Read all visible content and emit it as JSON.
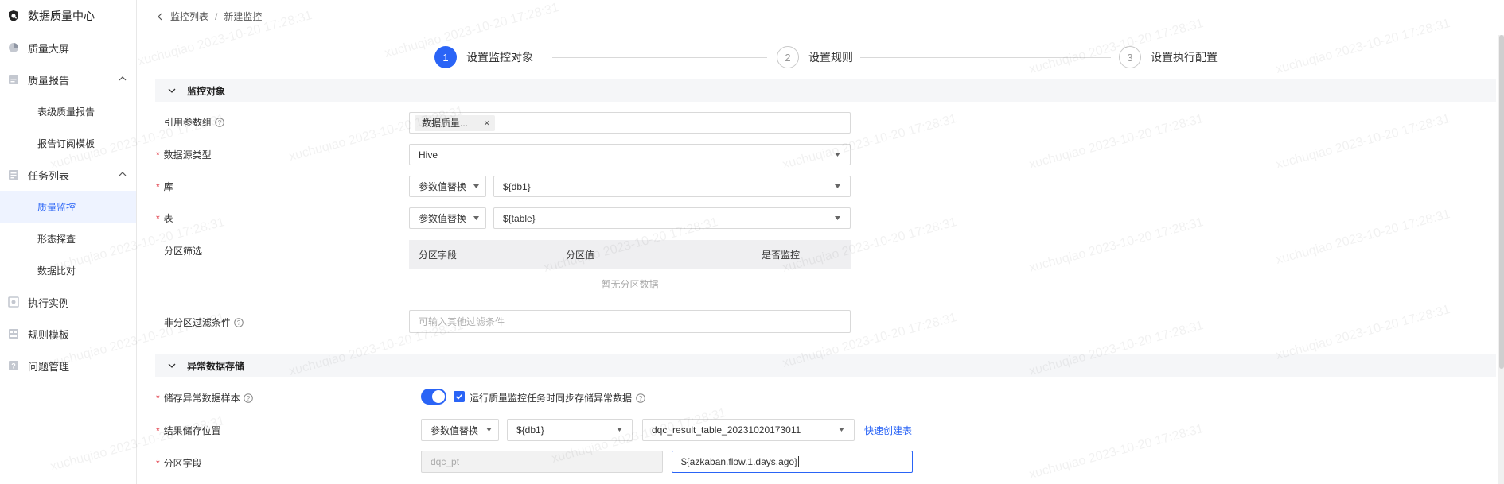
{
  "app": {
    "title": "数据质量中心"
  },
  "sidebar": {
    "items": [
      {
        "label": "质量大屏",
        "icon": "pie-chart-icon"
      },
      {
        "label": "质量报告",
        "icon": "report-icon",
        "expanded": true,
        "children": [
          {
            "label": "表级质量报告"
          },
          {
            "label": "报告订阅模板"
          }
        ]
      },
      {
        "label": "任务列表",
        "icon": "task-list-icon",
        "expanded": true,
        "children": [
          {
            "label": "质量监控",
            "active": true
          },
          {
            "label": "形态探查"
          },
          {
            "label": "数据比对"
          }
        ]
      },
      {
        "label": "执行实例",
        "icon": "instance-icon"
      },
      {
        "label": "规则模板",
        "icon": "template-icon"
      },
      {
        "label": "问题管理",
        "icon": "issue-icon"
      }
    ]
  },
  "breadcrumb": {
    "parent": "监控列表",
    "separator": "/",
    "current": "新建监控"
  },
  "steps": [
    {
      "num": "1",
      "label": "设置监控对象",
      "active": true
    },
    {
      "num": "2",
      "label": "设置规则",
      "active": false
    },
    {
      "num": "3",
      "label": "设置执行配置",
      "active": false
    }
  ],
  "section_monitor": {
    "title": "监控对象",
    "param_group": {
      "label": "引用参数组",
      "tag": "数据质量..."
    },
    "source_type": {
      "label": "数据源类型",
      "value": "Hive"
    },
    "db": {
      "label": "库",
      "mode": "参数值替换",
      "value": "${db1}"
    },
    "table": {
      "label": "表",
      "mode": "参数值替换",
      "value": "${table}"
    },
    "partition": {
      "label": "分区筛选",
      "columns": [
        "分区字段",
        "分区值",
        "是否监控"
      ],
      "empty": "暂无分区数据"
    },
    "filter": {
      "label": "非分区过滤条件",
      "placeholder": "可输入其他过滤条件"
    }
  },
  "section_abnormal": {
    "title": "异常数据存储",
    "store_sample": {
      "label": "储存异常数据样本",
      "enabled": true,
      "checkbox_label": "运行质量监控任务时同步存储异常数据",
      "checked": true
    },
    "result_location": {
      "label": "结果储存位置",
      "mode": "参数值替换",
      "db": "${db1}",
      "table": "dqc_result_table_20231020173011",
      "link": "快速创建表"
    },
    "partition_field": {
      "label": "分区字段",
      "name": "dqc_pt",
      "value": "${azkaban.flow.1.days.ago}"
    }
  },
  "watermark": {
    "text": "xuchuqiao 2023-10-20 17:28:31"
  },
  "colors": {
    "accent": "#2a64f6",
    "required": "#e0303c"
  }
}
